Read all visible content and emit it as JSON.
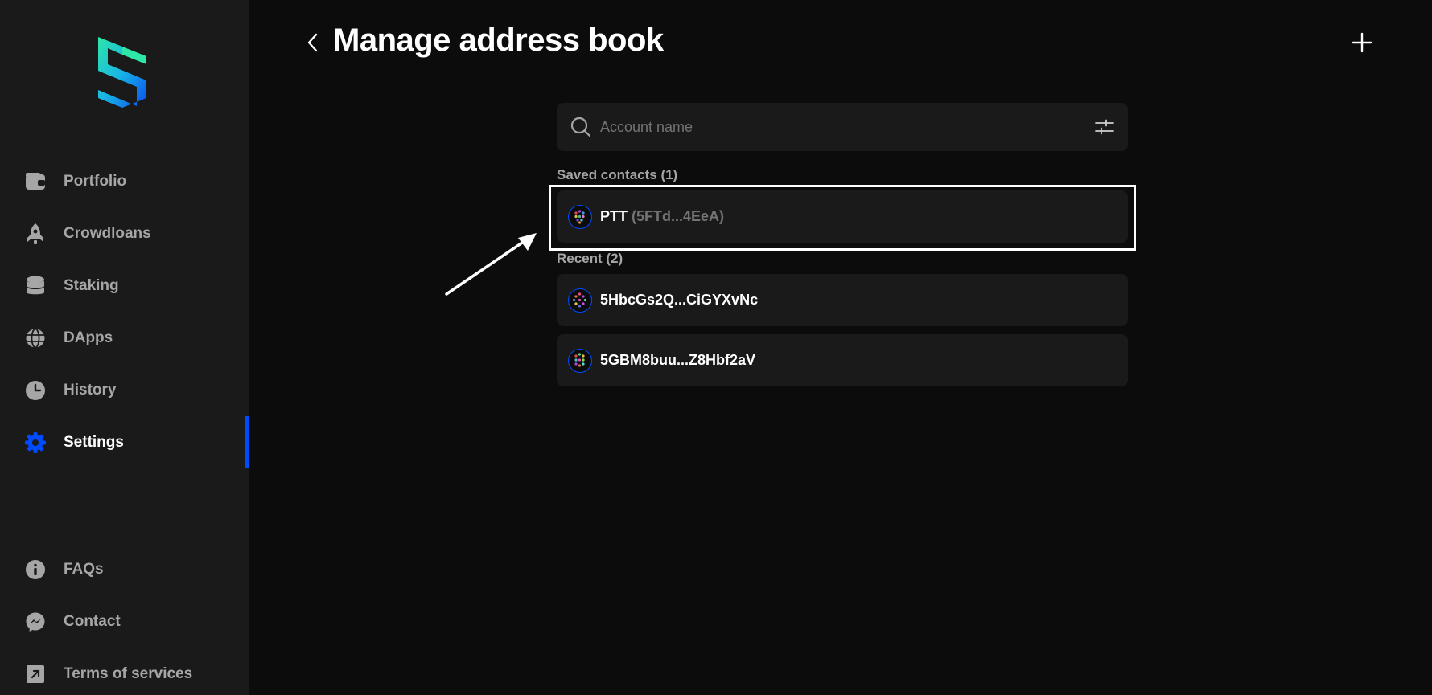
{
  "sidebar": {
    "logo": "subwallet-logo",
    "items": [
      {
        "label": "Portfolio",
        "icon": "wallet-icon"
      },
      {
        "label": "Crowdloans",
        "icon": "rocket-icon"
      },
      {
        "label": "Staking",
        "icon": "database-icon"
      },
      {
        "label": "DApps",
        "icon": "globe-icon"
      },
      {
        "label": "History",
        "icon": "clock-icon"
      },
      {
        "label": "Settings",
        "icon": "gear-icon",
        "active": true
      }
    ],
    "bottom_items": [
      {
        "label": "FAQs",
        "icon": "info-icon"
      },
      {
        "label": "Contact",
        "icon": "messenger-icon"
      },
      {
        "label": "Terms of services",
        "icon": "arrow-square-out-icon"
      }
    ]
  },
  "header": {
    "title": "Manage address book",
    "back_icon": "chevron-left-icon",
    "add_icon": "plus-icon"
  },
  "search": {
    "placeholder": "Account name",
    "value": "",
    "search_icon": "search-icon",
    "filter_icon": "sliders-icon"
  },
  "saved_section": {
    "label": "Saved contacts (1)",
    "contacts": [
      {
        "name": "PTT",
        "address": "(5FTd...4EeA)"
      }
    ]
  },
  "recent_section": {
    "label": "Recent (2)",
    "contacts": [
      {
        "address": "5HbcGs2Q...CiGYXvNc"
      },
      {
        "address": "5GBM8buu...Z8Hbf2aV"
      }
    ]
  },
  "colors": {
    "accent": "#004bff",
    "background": "#0c0c0c",
    "sidebar": "#1a1a1a",
    "card": "#1a1a1a",
    "muted_text": "#a6a6a6"
  }
}
